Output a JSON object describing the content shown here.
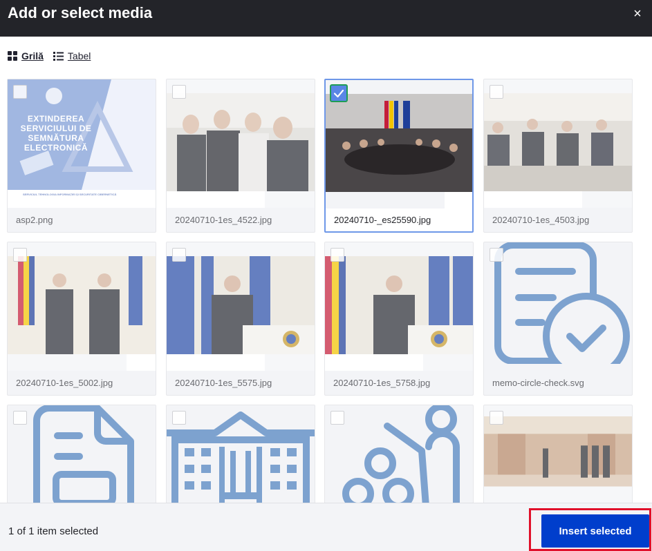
{
  "dialog": {
    "title": "Add or select media",
    "close_glyph": "×"
  },
  "view_tabs": [
    {
      "label": "Grilă",
      "icon": "grid-icon",
      "active": true
    },
    {
      "label": "Tabel",
      "icon": "list-icon",
      "active": false
    }
  ],
  "media": [
    {
      "filename": "asp2.png",
      "kind": "image",
      "selected": false
    },
    {
      "filename": "20240710-1es_4522.jpg",
      "kind": "image",
      "selected": false
    },
    {
      "filename": "20240710-_es25590.jpg",
      "kind": "image",
      "selected": true
    },
    {
      "filename": "20240710-1es_4503.jpg",
      "kind": "image",
      "selected": false
    },
    {
      "filename": "20240710-1es_5002.jpg",
      "kind": "image",
      "selected": false
    },
    {
      "filename": "20240710-1es_5575.jpg",
      "kind": "image",
      "selected": false
    },
    {
      "filename": "20240710-1es_5758.jpg",
      "kind": "image",
      "selected": false
    },
    {
      "filename": "memo-circle-check.svg",
      "kind": "icon",
      "icon": "memo-circle-check-icon",
      "selected": false
    },
    {
      "filename": "",
      "kind": "icon",
      "icon": "file-lines-icon",
      "selected": false
    },
    {
      "filename": "",
      "kind": "icon",
      "icon": "building-columns-icon",
      "selected": false
    },
    {
      "filename": "",
      "kind": "icon",
      "icon": "person-chalkboard-icon",
      "selected": false
    },
    {
      "filename": "",
      "kind": "image",
      "selected": false
    }
  ],
  "thumbnail_text": {
    "banner_lines": [
      "EXTINDEREA",
      "SERVICIULUI DE",
      "SEMNĂTURA",
      "ELECTRONICĂ"
    ],
    "banner_footer": "SERVICIUL TEHNOLOGIA INFORMAȚIEI ȘI SECURITATE CIBERNETICĂ"
  },
  "footer": {
    "status": "1 of 1 item selected",
    "insert_label": "Insert selected"
  },
  "colors": {
    "titlebar": "#232429",
    "primary_button": "#003ecc",
    "selected_border": "#6e97e8",
    "highlight_box": "#e0102a",
    "icon_blue": "#7da2cf"
  }
}
